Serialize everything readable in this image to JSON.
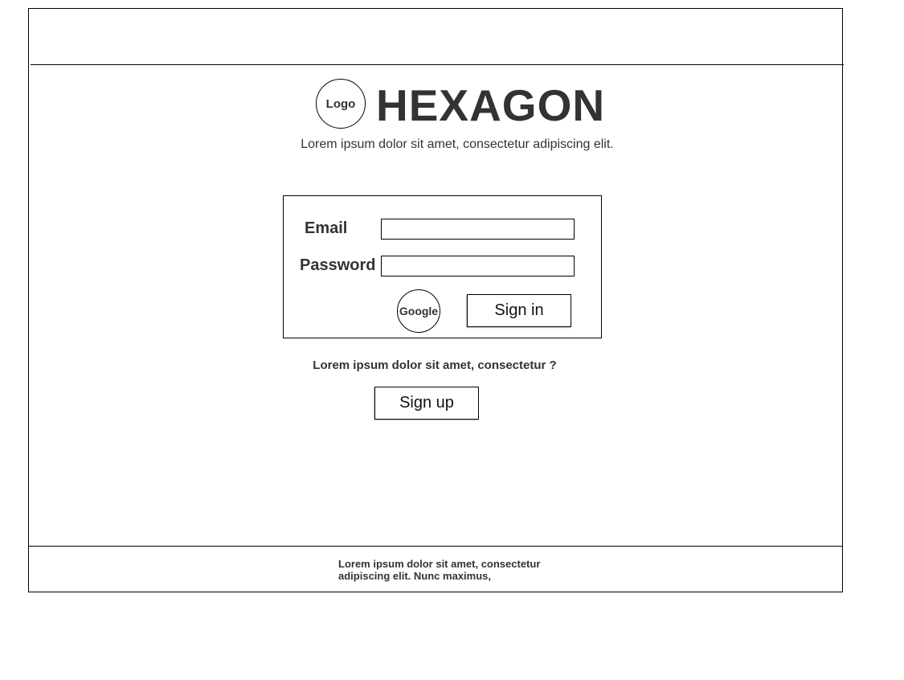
{
  "header": {
    "logo_label": "Logo",
    "brand_name": "HEXAGON",
    "tagline": "Lorem ipsum dolor sit amet, consectetur adipiscing elit."
  },
  "login_form": {
    "email_label": "Email",
    "email_value": "",
    "password_label": "Password",
    "password_value": "",
    "google_label": "Google",
    "signin_label": "Sign in"
  },
  "signup": {
    "prompt": "Lorem ipsum dolor sit amet, consectetur ?",
    "button_label": "Sign up"
  },
  "footer": {
    "line1": "Lorem ipsum dolor sit amet, consectetur",
    "line2": "adipiscing elit. Nunc maximus,"
  }
}
